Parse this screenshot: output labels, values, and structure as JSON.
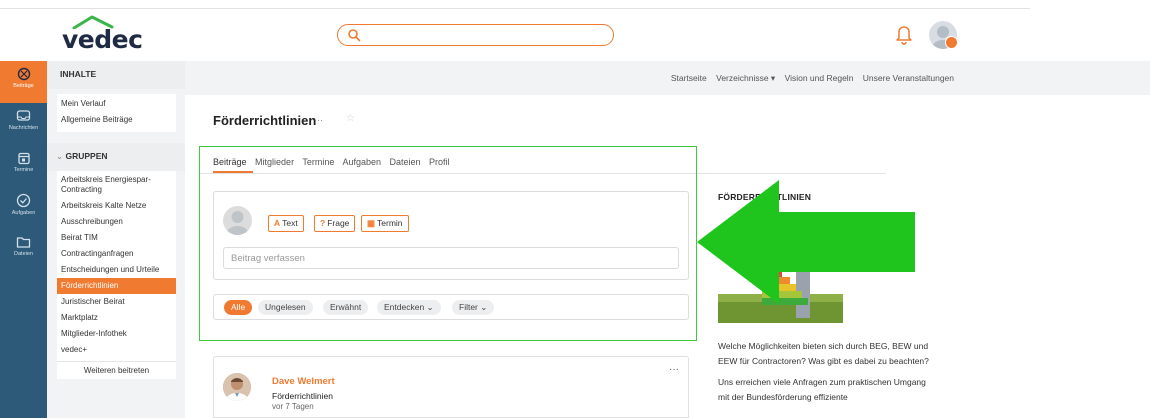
{
  "header": {
    "logo_text": "vedec",
    "search_placeholder": ""
  },
  "rail": {
    "items": [
      {
        "label": "Beiträge",
        "icon": "contributions-icon",
        "active": true
      },
      {
        "label": "Nachrichten",
        "icon": "messages-icon",
        "active": false
      },
      {
        "label": "Termine",
        "icon": "calendar-icon",
        "active": false
      },
      {
        "label": "Aufgaben",
        "icon": "tasks-icon",
        "active": false
      },
      {
        "label": "Dateien",
        "icon": "folder-icon",
        "active": false
      }
    ]
  },
  "sidebar": {
    "content_heading": "INHALTE",
    "content_items": [
      "Mein Verlauf",
      "Allgemeine Beiträge"
    ],
    "groups_heading": "GRUPPEN",
    "group_items": [
      "Arbeitskreis Energiespar-Contracting",
      "Arbeitskreis Kalte Netze",
      "Ausschreibungen",
      "Beirat TIM",
      "Contractinganfragen",
      "Entscheidungen und Urteile",
      "Förderrichtlinien",
      "Juristischer Beirat",
      "Marktplatz",
      "Mitglieder-Infothek",
      "vedec+"
    ],
    "active_group": "Förderrichtlinien",
    "join_label": "Weiteren beitreten"
  },
  "subnav": {
    "items": [
      "Startseite",
      "Verzeichnisse ▾",
      "Vision und Regeln",
      "Unsere Veranstaltungen"
    ]
  },
  "main": {
    "title": "Förderrichtlinien",
    "title_dots": "···",
    "title_star": "☆",
    "tabs": [
      "Beiträge",
      "Mitglieder",
      "Termine",
      "Aufgaben",
      "Dateien",
      "Profil"
    ],
    "active_tab": "Beiträge",
    "composer": {
      "buttons": [
        {
          "icon": "A",
          "label": "Text"
        },
        {
          "icon": "?",
          "label": "Frage"
        },
        {
          "icon": "▦",
          "label": "Termin"
        }
      ],
      "placeholder": "Beitrag verfassen"
    },
    "filters": {
      "chips": [
        "Alle",
        "Ungelesen",
        "Erwähnt",
        "Entdecken ⌄",
        "Filter ⌄"
      ],
      "active": "Alle"
    },
    "post": {
      "author": "Dave Welmert",
      "group": "Förderrichtlinien",
      "time": "vor 7 Tagen",
      "more": "···"
    }
  },
  "right": {
    "title": "FÖRDERRICHTLINIEN",
    "paragraphs": [
      "Welche Möglichkeiten bieten sich durch BEG, BEW und EEW für Contractoren? Was gibt es dabei zu beachten?",
      "Uns erreichen viele Anfragen zum praktischen Umgang mit der Bundesförderung effiziente"
    ]
  },
  "colors": {
    "accent": "#f07a30",
    "rail": "#2d5a78",
    "highlight": "#3fc93a"
  }
}
